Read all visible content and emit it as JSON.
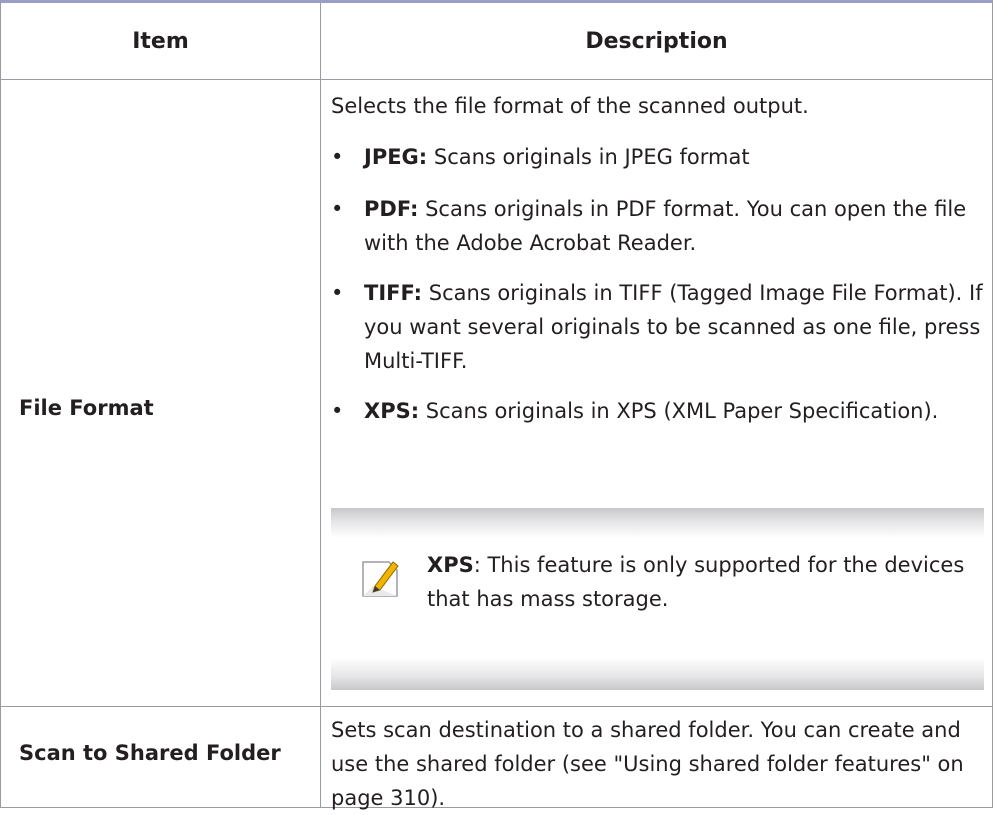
{
  "header": {
    "item": "Item",
    "description": "Description"
  },
  "rows": [
    {
      "item": "File Format",
      "intro": "Selects the file format of the scanned output.",
      "bullets": [
        {
          "term": "JPEG:",
          "text": " Scans originals in JPEG format"
        },
        {
          "term": "PDF:",
          "text": " Scans originals in PDF format. You can open the file with the Adobe Acrobat Reader."
        },
        {
          "term": "TIFF:",
          "text": " Scans originals in TIFF (Tagged Image File Format). If you want several originals to be scanned as one file, press Multi-TIFF."
        },
        {
          "term": "XPS:",
          "text": " Scans originals in XPS (XML Paper Specification)."
        }
      ],
      "note": {
        "icon": "note-pencil-icon",
        "term": "XPS",
        "text": ": This feature is only supported for the devices that has mass storage."
      }
    },
    {
      "item": "Scan to Shared Folder",
      "description": "Sets scan destination to a shared folder. You can create and use the shared folder (see \"Using shared folder features\" on page 310)."
    }
  ],
  "colors": {
    "header_rule": "#9a9dc6",
    "grid": "#9a9aa2",
    "text": "#231f20",
    "note_band": "#c8c8ca"
  }
}
